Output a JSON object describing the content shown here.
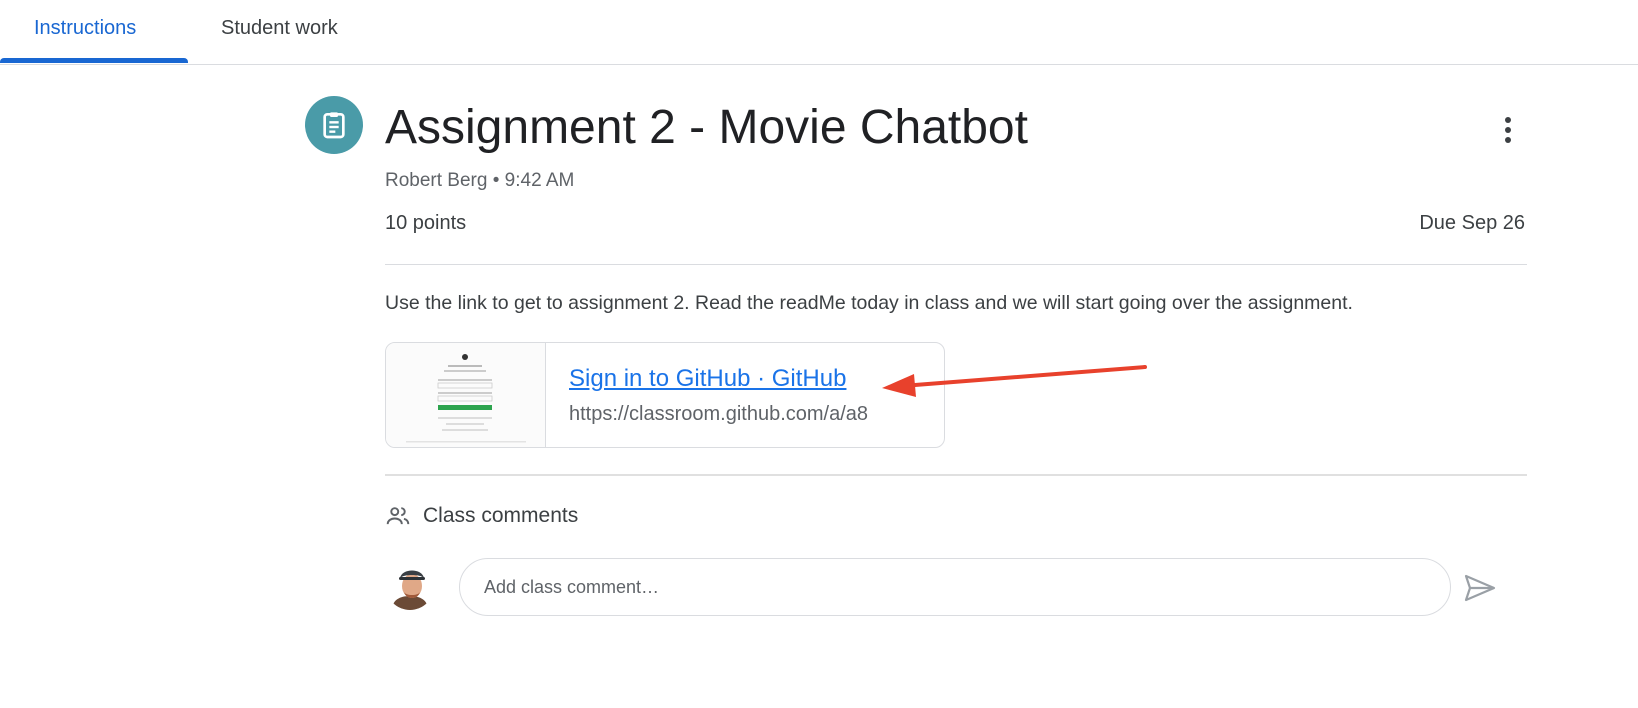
{
  "tabs": [
    {
      "label": "Instructions",
      "active": true
    },
    {
      "label": "Student work",
      "active": false
    }
  ],
  "assignment": {
    "icon": "assignment-icon",
    "title": "Assignment 2 - Movie Chatbot",
    "meta": "Robert Berg • 9:42 AM",
    "points": "10 points",
    "due": "Due Sep 26",
    "description": "Use the link to get to assignment 2.  Read the readMe today in class and we will start going over the assignment."
  },
  "attachment": {
    "title": "Sign in to GitHub · GitHub",
    "url": "https://classroom.github.com/a/a8"
  },
  "comments": {
    "icon": "people-icon",
    "label": "Class comments",
    "placeholder": "Add class comment…"
  },
  "colors": {
    "accent": "#1967d2",
    "icon_teal": "#4a9ba8",
    "link": "#1a73e8",
    "annotation_arrow": "#e8412c"
  }
}
